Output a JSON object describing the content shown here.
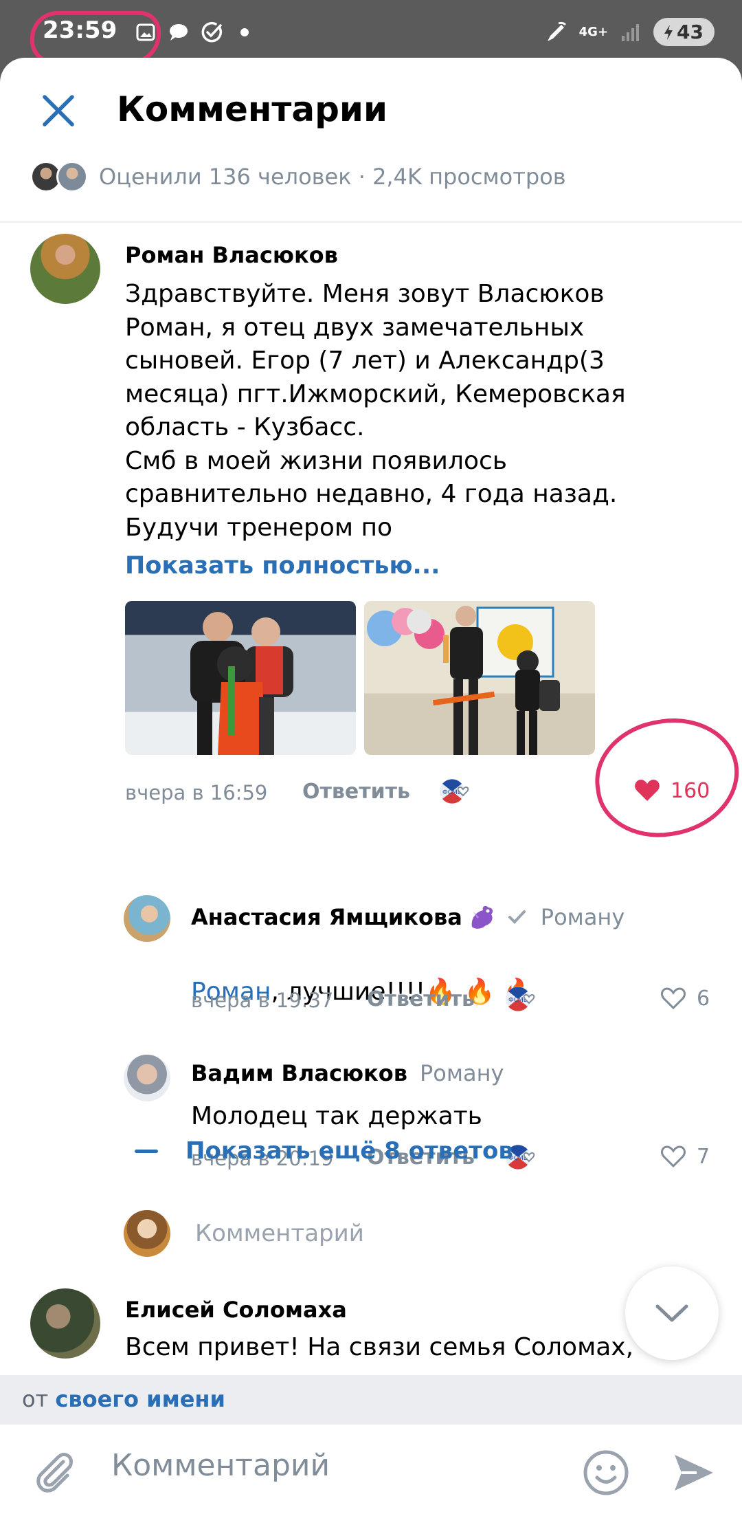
{
  "status_bar": {
    "time": "23:59",
    "network": "4G+",
    "battery": "43"
  },
  "header": {
    "title": "Комментарии",
    "likes_views": "Оценили 136 человек · 2,4K просмотров"
  },
  "comments": [
    {
      "author": "Роман Власюков",
      "text": "Здравствуйте. Меня зовут Власюков\nРоман, я отец двух замечательных\nсыновей. Егор (7 лет) и Александр(3\nмесяца) пгт.Ижморский, Кемеровская\nобласть - Кузбасс.\nСмб в моей жизни появилось\nсравнительно недавно, 4 года назад.\nБудучи тренером по",
      "show_more": "Показать полностью...",
      "time": "вчера в 16:59",
      "reply": "Ответить",
      "likes": "160"
    },
    {
      "author": "Анастасия Ямщикова",
      "reply_to": "Роману",
      "mention": "Роман",
      "text": ", лучшие!!!!",
      "emoji": "🔥 🔥 🔥",
      "time": "вчера в 19:37",
      "reply": "Ответить",
      "likes": "6"
    },
    {
      "author": "Вадим Власюков",
      "reply_to": "Роману",
      "text": "Молодец так держать",
      "time": "вчера в 20:19",
      "reply": "Ответить",
      "likes": "7"
    },
    {
      "author": "Елисей Соломаха",
      "text": "Всем привет! На связи семья Соломах,"
    }
  ],
  "thread": {
    "show_more_replies": "Показать ещё 8 ответов",
    "reply_placeholder": "Комментарий"
  },
  "composer": {
    "from_prefix": "от",
    "from_name": "своего имени",
    "placeholder": "Комментарий"
  }
}
